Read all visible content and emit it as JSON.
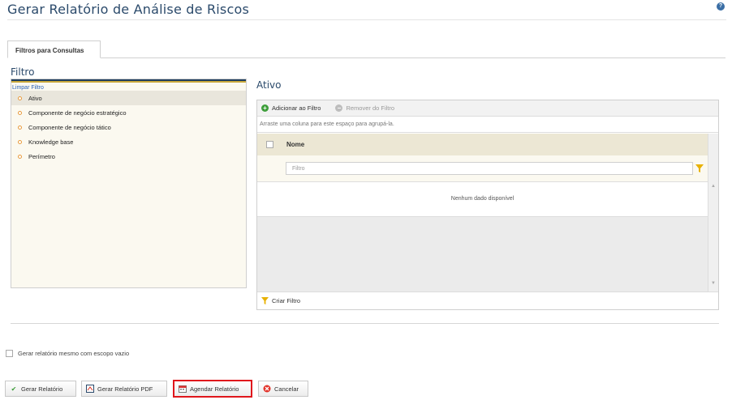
{
  "page": {
    "title": "Gerar Relatório de Análise de Riscos",
    "help_icon": "help-icon"
  },
  "tabs": [
    {
      "label": "Filtros para Consultas",
      "active": true
    }
  ],
  "filter_panel": {
    "title": "Filtro",
    "clear_link": "Limpar Filtro",
    "items": [
      {
        "label": "Ativo",
        "selected": true
      },
      {
        "label": "Componente de negócio estratégico",
        "selected": false
      },
      {
        "label": "Componente de negócio tático",
        "selected": false
      },
      {
        "label": "Knowledge base",
        "selected": false
      },
      {
        "label": "Perímetro",
        "selected": false
      }
    ]
  },
  "grid": {
    "title": "Ativo",
    "toolbar": {
      "add_label": "Adicionar ao Filtro",
      "remove_label": "Remover do Filtro"
    },
    "group_hint": "Arraste uma coluna para este espaço para agrupá-la.",
    "columns": [
      "Nome"
    ],
    "filter_placeholder": "Filtro",
    "empty_text": "Nenhum dado disponível",
    "footer_label": "Criar Filtro"
  },
  "options": {
    "empty_scope_label": "Gerar relatório mesmo com escopo vazio",
    "empty_scope_checked": false
  },
  "actions": {
    "generate": "Gerar Relatório",
    "generate_pdf": "Gerar Relatório PDF",
    "schedule": "Agendar Relatório",
    "cancel": "Cancelar"
  },
  "colors": {
    "title": "#2b4a6b",
    "accent_bar": "#1d3c5e",
    "highlight_border": "#e0161c",
    "add_green": "#3d9e3a"
  }
}
